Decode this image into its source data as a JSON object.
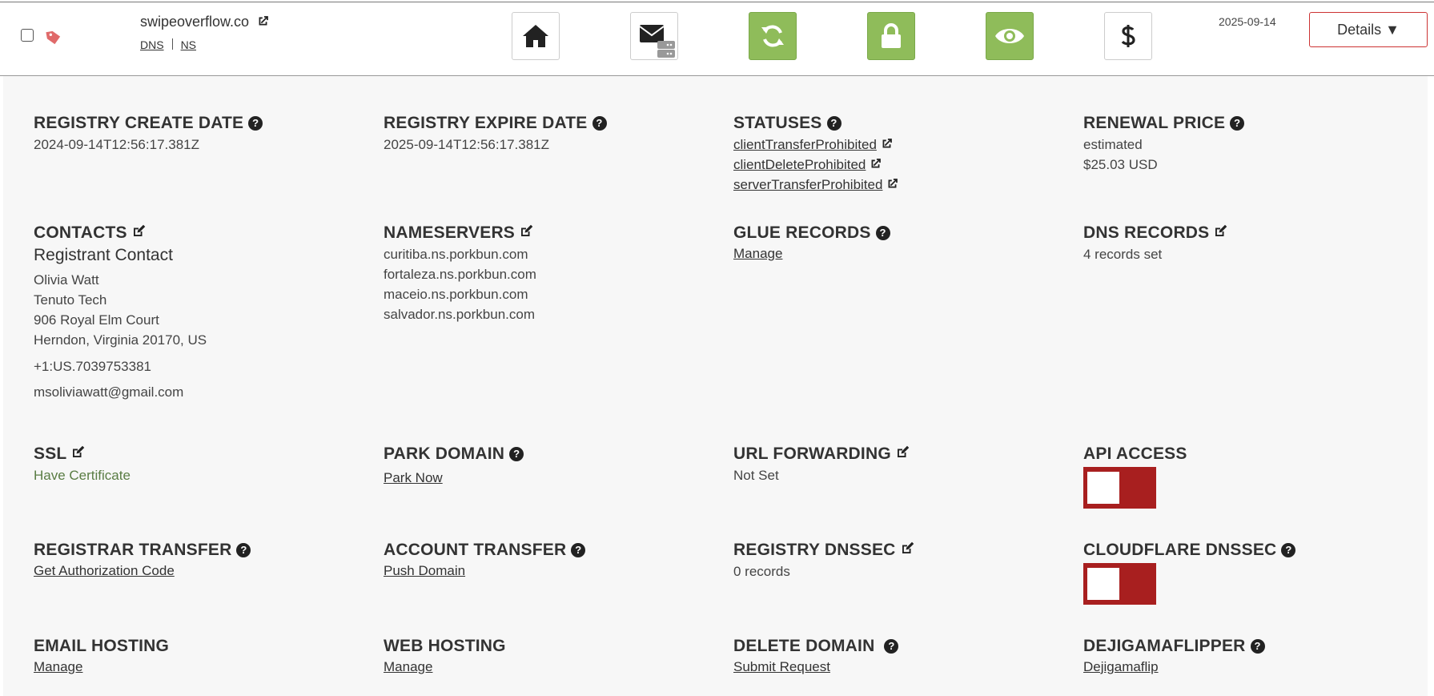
{
  "domain": {
    "name": "swipeoverflow.co",
    "links": [
      "DNS",
      "NS"
    ],
    "expiry": "2025-09-14",
    "details_label": "Details ▼"
  },
  "toolbar": {
    "icons": [
      "home-icon",
      "email-server-icon",
      "sync-icon",
      "lock-icon",
      "eye-icon",
      "dollar-icon"
    ],
    "accent_green": "#8fbc5a",
    "accent_red": "#a81f1f"
  },
  "fields": {
    "registry_create": {
      "title": "REGISTRY CREATE DATE",
      "value": "2024-09-14T12:56:17.381Z"
    },
    "registry_expire": {
      "title": "REGISTRY EXPIRE DATE",
      "value": "2025-09-14T12:56:17.381Z"
    },
    "statuses": {
      "title": "STATUSES",
      "items": [
        "clientTransferProhibited",
        "clientDeleteProhibited",
        "serverTransferProhibited"
      ]
    },
    "renewal": {
      "title": "RENEWAL PRICE",
      "line1": "estimated",
      "line2": "$25.03 USD"
    },
    "contacts": {
      "title": "CONTACTS",
      "subtitle": "Registrant Contact",
      "name": "Olivia Watt",
      "org": "Tenuto Tech",
      "street": "906 Royal Elm Court",
      "city": "Herndon, Virginia 20170, US",
      "phone": "+1:US.7039753381",
      "email": "msoliviawatt@gmail.com"
    },
    "nameservers": {
      "title": "NAMESERVERS",
      "items": [
        "curitiba.ns.porkbun.com",
        "fortaleza.ns.porkbun.com",
        "maceio.ns.porkbun.com",
        "salvador.ns.porkbun.com"
      ]
    },
    "glue": {
      "title": "GLUE RECORDS",
      "link": "Manage"
    },
    "dns_records": {
      "title": "DNS RECORDS",
      "value": "4 records set"
    },
    "ssl": {
      "title": "SSL",
      "value": "Have Certificate"
    },
    "park": {
      "title": "PARK DOMAIN",
      "link": "Park Now"
    },
    "url_forwarding": {
      "title": "URL FORWARDING",
      "value": "Not Set"
    },
    "api_access": {
      "title": "API ACCESS",
      "enabled": false
    },
    "registrar_transfer": {
      "title": "REGISTRAR TRANSFER",
      "link": "Get Authorization Code"
    },
    "account_transfer": {
      "title": "ACCOUNT TRANSFER",
      "link": "Push Domain"
    },
    "registry_dnssec": {
      "title": "REGISTRY DNSSEC",
      "value": "0 records"
    },
    "cloudflare_dnssec": {
      "title": "CLOUDFLARE DNSSEC",
      "enabled": false
    },
    "email_hosting": {
      "title": "EMAIL HOSTING",
      "link": "Manage"
    },
    "web_hosting": {
      "title": "WEB HOSTING",
      "link": "Manage"
    },
    "delete_domain": {
      "title": "DELETE DOMAIN",
      "link": "Submit Request"
    },
    "dejigamaflipper": {
      "title": "DEJIGAMAFLIPPER",
      "link": "Dejigamaflip"
    }
  }
}
